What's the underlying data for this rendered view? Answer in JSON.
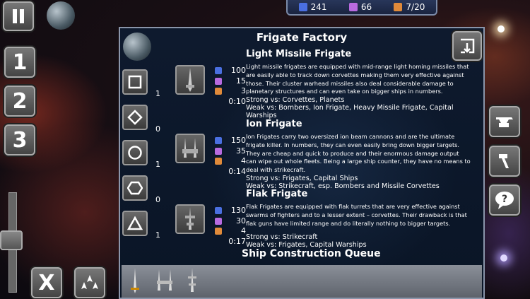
{
  "resources": {
    "crystal": "241",
    "gas": "66",
    "ships": "7/20",
    "crystal_color": "#4a6fe0",
    "gas_color": "#b86ae0",
    "ships_color": "#e08a3a"
  },
  "left_controls": {
    "pause_icon": "pause-icon",
    "group_1": "1",
    "group_2": "2",
    "group_3": "3",
    "close_label": "X"
  },
  "panel": {
    "title": "Frigate Factory",
    "queue_title": "Ship Construction Queue"
  },
  "shape_counts": [
    "1",
    "0",
    "1",
    "0",
    "1"
  ],
  "frigates": [
    {
      "name": "Light Missile Frigate",
      "description": "Light missile frigates are equipped with mid-range light homing missiles that are easily able to track down corvettes making them very effective against those. Their cluster warhead missiles also deal considerable damage to planetary structures and can even take on bigger ships in numbers.",
      "strong": "Strong vs: Corvettes, Planets",
      "weak": "Weak vs: Bombers, Ion Frigate, Heavy Missile Frigate, Capital Warships",
      "crystal": "100",
      "gas": "15",
      "pop": "3",
      "time": "0:10"
    },
    {
      "name": "Ion Frigate",
      "description": "Ion Frigates carry two oversized ion beam cannons and are the ultimate frigate killer. In numbers, they can even easily bring down bigger targets. They are cheap and quick to produce and their enormous damage output can wipe out whole fleets. Being a large ship counter, they have no means to deal with strikecraft.",
      "strong": "Strong vs: Frigates, Capital Ships",
      "weak": "Weak vs: Strikecraft, esp. Bombers and Missile Corvettes",
      "crystal": "150",
      "gas": "35",
      "pop": "4",
      "time": "0:14"
    },
    {
      "name": "Flak Frigate",
      "description": "Flak Frigates are equipped with flak turrets that are very effective against swarms of fighters and to a lesser extent – corvettes. Their drawback is that flak guns have limited range and do literally nothing to bigger targets.",
      "strong": "Strong vs: Strikecraft",
      "weak": "Weak vs: Frigates, Capital Warships",
      "crystal": "130",
      "gas": "30",
      "pop": "4",
      "time": "0:17"
    }
  ]
}
